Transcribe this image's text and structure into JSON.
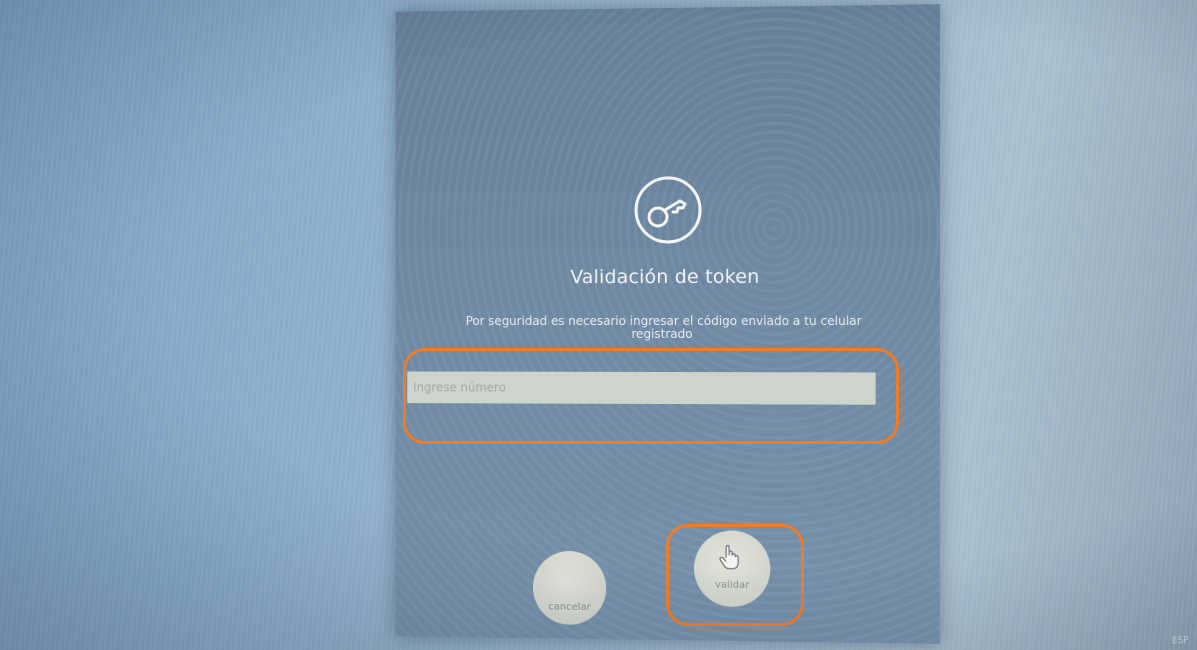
{
  "dialog": {
    "title": "Validación de token",
    "description": "Por seguridad es necesario ingresar el código enviado a tu celular registrado",
    "input": {
      "placeholder": "Ingrese número",
      "value": ""
    },
    "buttons": {
      "cancel_label": "cancelar",
      "validate_label": "validar"
    },
    "icon": "key-icon"
  },
  "annotations": {
    "highlight_color": "#f07c2a"
  },
  "taskbar": {
    "language": "ESP"
  }
}
